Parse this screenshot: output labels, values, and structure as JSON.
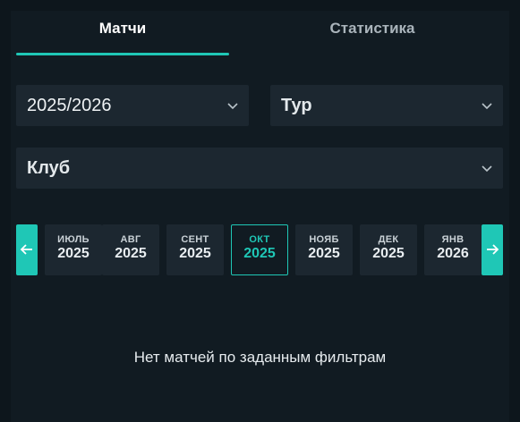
{
  "tabs": {
    "matches": "Матчи",
    "statistics": "Статистика"
  },
  "filters": {
    "season": "2025/2026",
    "round": "Тур",
    "club": "Клуб"
  },
  "months": [
    {
      "month": "ИЮЛЬ",
      "year": "2025"
    },
    {
      "month": "АВГ",
      "year": "2025"
    },
    {
      "month": "СЕНТ",
      "year": "2025"
    },
    {
      "month": "ОКТ",
      "year": "2025"
    },
    {
      "month": "НОЯБ",
      "year": "2025"
    },
    {
      "month": "ДЕК",
      "year": "2025"
    },
    {
      "month": "ЯНВ",
      "year": "2026"
    }
  ],
  "active_month": "ОКТ 2025",
  "empty_message": "Нет матчей по заданным фильтрам",
  "colors": {
    "accent": "#1fc7b6",
    "background": "#111b22",
    "control": "#1c2730"
  },
  "icons": {
    "chevron": "chevron-down-icon",
    "prev": "arrow-left-icon",
    "next": "arrow-right-icon"
  }
}
